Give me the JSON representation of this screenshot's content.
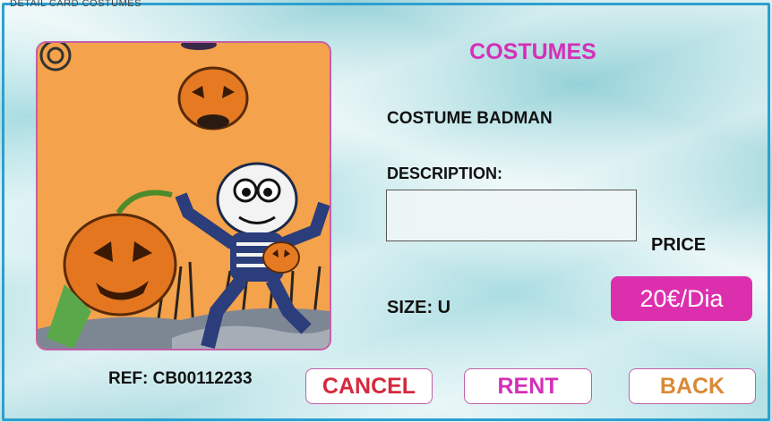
{
  "screen": {
    "top_label": "DETAIL CARD COSTUMES",
    "title": "COSTUMES"
  },
  "costume": {
    "name": "COSTUME BADMAN",
    "description_label": "DESCRIPTION:",
    "description_value": "",
    "price_label": "PRICE",
    "price": "20€/Dia",
    "size": "SIZE: U",
    "ref": "REF: CB00112233"
  },
  "buttons": {
    "cancel": "CANCEL",
    "rent": "RENT",
    "back": "BACK"
  },
  "colors": {
    "accent": "#d42fb8",
    "frame": "#2e9fd0",
    "cancel": "#d5293d",
    "back": "#d98a36"
  },
  "image": {
    "icon": "halloween-skeleton-pumpkins-illustration"
  }
}
